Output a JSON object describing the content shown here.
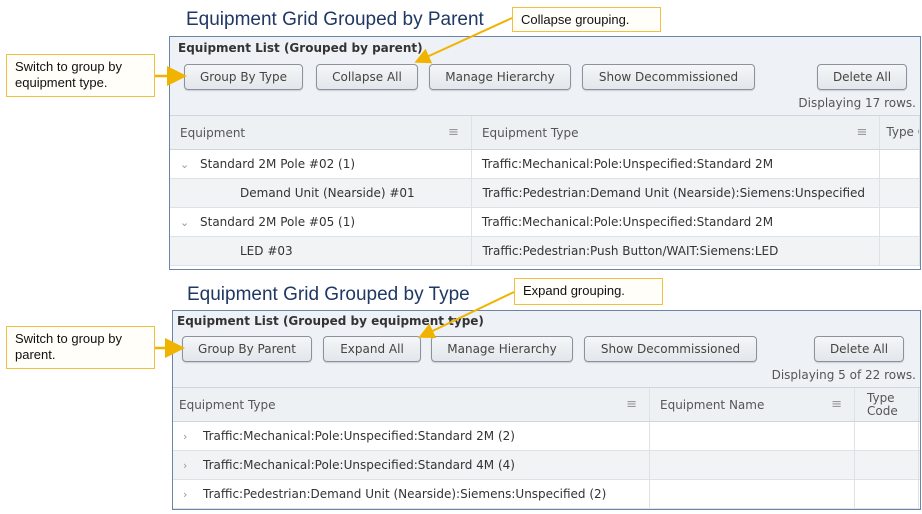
{
  "top": {
    "section_title": "Equipment Grid Grouped by Parent",
    "callout_left": "Switch to group by equipment type.",
    "callout_top": "Collapse grouping.",
    "panel_title": "Equipment List (Grouped by parent)",
    "buttons": {
      "group_by": "Group By Type",
      "collapse": "Collapse All",
      "manage": "Manage Hierarchy",
      "decommissioned": "Show Decommissioned",
      "delete": "Delete All"
    },
    "row_count": "Displaying 17 rows.",
    "columns": [
      "Equipment",
      "Equipment Type",
      "Type Code"
    ],
    "rows": [
      {
        "equipment": "Standard 2M Pole #02  (1)",
        "type": "Traffic:Mechanical:Pole:Unspecified:Standard 2M",
        "group": true
      },
      {
        "equipment": "Demand Unit (Nearside) #01",
        "type": "Traffic:Pedestrian:Demand Unit (Nearside):Siemens:Unspecified",
        "group": false
      },
      {
        "equipment": "Standard 2M Pole #05  (1)",
        "type": "Traffic:Mechanical:Pole:Unspecified:Standard 2M",
        "group": true
      },
      {
        "equipment": "LED #03",
        "type": "Traffic:Pedestrian:Push Button/WAIT:Siemens:LED",
        "group": false
      }
    ]
  },
  "bottom": {
    "section_title": "Equipment Grid Grouped by Type",
    "callout_left": "Switch to group by parent.",
    "callout_top": "Expand grouping.",
    "panel_title": "Equipment List (Grouped by equipment type)",
    "buttons": {
      "group_by": "Group By Parent",
      "expand": "Expand All",
      "manage": "Manage Hierarchy",
      "decommissioned": "Show Decommissioned",
      "delete": "Delete All"
    },
    "row_count": "Displaying 5 of 22 rows.",
    "columns": [
      "Equipment Type",
      "Equipment Name",
      "Type Code"
    ],
    "rows": [
      {
        "type": "Traffic:Mechanical:Pole:Unspecified:Standard 2M  (2)"
      },
      {
        "type": "Traffic:Mechanical:Pole:Unspecified:Standard 4M  (4)"
      },
      {
        "type": "Traffic:Pedestrian:Demand Unit (Nearside):Siemens:Unspecified  (2)"
      }
    ]
  },
  "icons": {
    "expanded": "⌄",
    "collapsed": "›",
    "column_menu": "≡"
  },
  "colors": {
    "callout_border": "#f0c040",
    "arrow": "#f0b400",
    "title": "#1f3864",
    "panel_border": "#6b84a8"
  }
}
